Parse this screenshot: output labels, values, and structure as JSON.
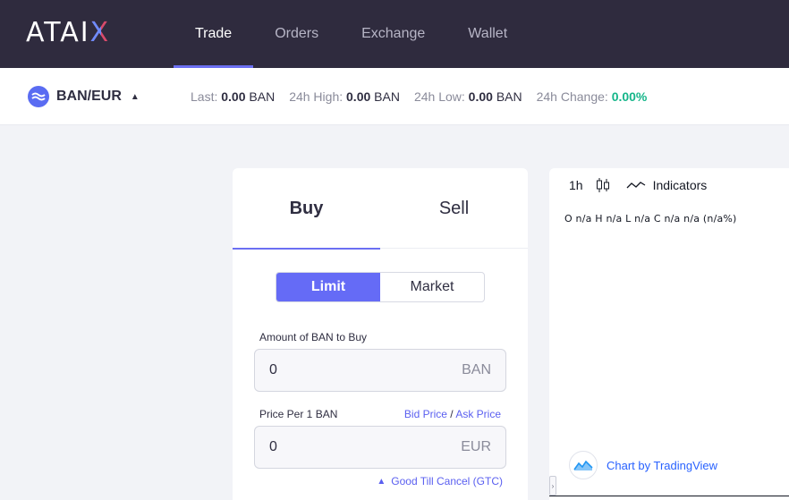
{
  "brand": {
    "logo_text": "ATAI",
    "logo_x": "X"
  },
  "nav": {
    "items": [
      {
        "label": "Trade",
        "active": true
      },
      {
        "label": "Orders",
        "active": false
      },
      {
        "label": "Exchange",
        "active": false
      },
      {
        "label": "Wallet",
        "active": false
      }
    ]
  },
  "ticker": {
    "pair": "BAN/EUR",
    "last_label": "Last:",
    "last_value": "0.00",
    "last_unit": "BAN",
    "high_label": "24h High:",
    "high_value": "0.00",
    "high_unit": "BAN",
    "low_label": "24h Low:",
    "low_value": "0.00",
    "low_unit": "BAN",
    "change_label": "24h Change:",
    "change_value": "0.00%"
  },
  "order": {
    "tabs": {
      "buy": "Buy",
      "sell": "Sell"
    },
    "types": {
      "limit": "Limit",
      "market": "Market"
    },
    "amount_label": "Amount of BAN to Buy",
    "amount_value": "0",
    "amount_currency": "BAN",
    "price_label": "Price Per 1 BAN",
    "bid_price": "Bid Price",
    "separator": "/",
    "ask_price": "Ask Price",
    "price_value": "0",
    "price_currency": "EUR",
    "gtc": "Good Till Cancel (GTC)"
  },
  "chart": {
    "interval": "1h",
    "indicators": "Indicators",
    "ohlc": "O n/a  H n/a  L n/a  C n/a   n/a (n/a%)",
    "credit": "Chart by TradingView"
  },
  "colors": {
    "accent": "#656bf6",
    "topbar": "#2f2b3e",
    "positive": "#16b68a"
  }
}
